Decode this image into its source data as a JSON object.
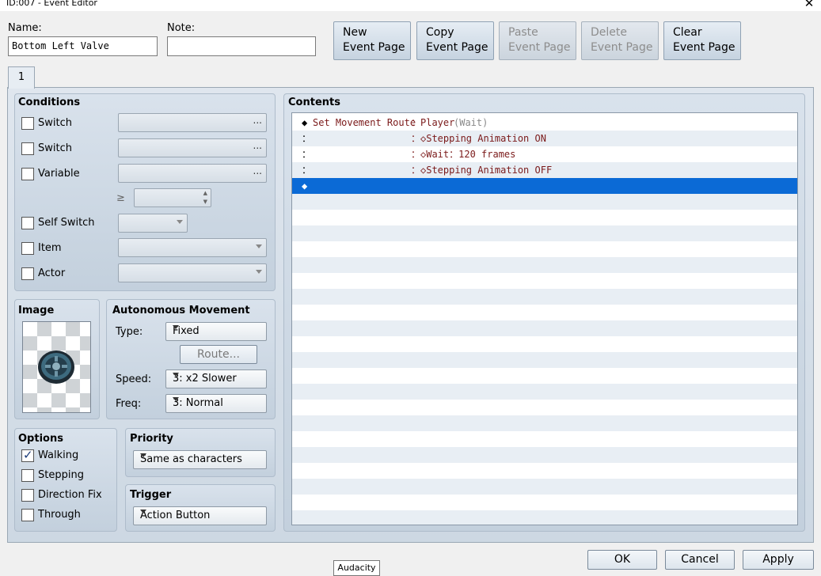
{
  "window": {
    "title": "ID:007 - Event Editor",
    "close_glyph": "✕"
  },
  "name_field": {
    "label": "Name:",
    "value": "Bottom Left Valve"
  },
  "note_field": {
    "label": "Note:",
    "value": ""
  },
  "toolbar": [
    {
      "line1": "New",
      "line2": "Event Page",
      "enabled": true
    },
    {
      "line1": "Copy",
      "line2": "Event Page",
      "enabled": true
    },
    {
      "line1": "Paste",
      "line2": "Event Page",
      "enabled": false
    },
    {
      "line1": "Delete",
      "line2": "Event Page",
      "enabled": false
    },
    {
      "line1": "Clear",
      "line2": "Event Page",
      "enabled": true
    }
  ],
  "tabs": [
    {
      "label": "1",
      "selected": true
    }
  ],
  "conditions": {
    "title": "Conditions",
    "switch1": "Switch",
    "switch2": "Switch",
    "variable": "Variable",
    "gte": "≥",
    "self_switch": "Self Switch",
    "item": "Item",
    "actor": "Actor",
    "ellipsis": "..."
  },
  "image": {
    "title": "Image",
    "sprite_icon": "valve-sprite-icon"
  },
  "autonomous_movement": {
    "title": "Autonomous Movement",
    "type_label": "Type:",
    "type_value": "Fixed",
    "route_button": "Route...",
    "speed_label": "Speed:",
    "speed_value": "3: x2 Slower",
    "freq_label": "Freq:",
    "freq_value": "3: Normal"
  },
  "options": {
    "title": "Options",
    "walking": "Walking",
    "walking_checked": true,
    "stepping": "Stepping",
    "direction_fix": "Direction Fix",
    "through": "Through"
  },
  "priority": {
    "title": "Priority",
    "value": "Same as characters"
  },
  "trigger": {
    "title": "Trigger",
    "value": "Action Button"
  },
  "contents": {
    "title": "Contents",
    "rows": [
      {
        "prefix": "◆",
        "command": "Set Movement Route",
        "sep": "：",
        "arg": "Player",
        "extra": " (Wait)"
      },
      {
        "prefix": "：",
        "command": "",
        "sep": "：",
        "arg": "◇Stepping Animation ON",
        "extra": ""
      },
      {
        "prefix": "：",
        "command": "",
        "sep": "：",
        "arg": "◇Wait：120 frames",
        "extra": ""
      },
      {
        "prefix": "：",
        "command": "",
        "sep": "：",
        "arg": "◇Stepping Animation OFF",
        "extra": ""
      },
      {
        "prefix": "◆",
        "command": "",
        "sep": "",
        "arg": "",
        "extra": ""
      }
    ]
  },
  "footer": {
    "ok": "OK",
    "cancel": "Cancel",
    "apply": "Apply"
  },
  "tooltip": "Audacity",
  "colors": {
    "selection": "#0b6ad6",
    "command_text": "#7b1a1a",
    "accent_panel": "#c3d0dd"
  }
}
